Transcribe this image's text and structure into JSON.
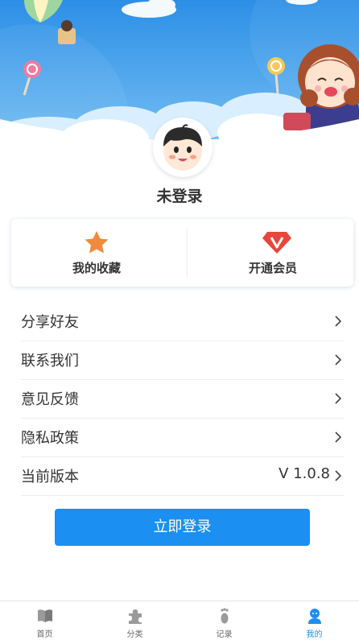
{
  "profile": {
    "username": "未登录"
  },
  "quick_actions": [
    {
      "label": "我的收藏",
      "icon": "star-icon",
      "color": "#f08a3c"
    },
    {
      "label": "开通会员",
      "icon": "vip-diamond-icon",
      "color": "#e8463c"
    }
  ],
  "menu": [
    {
      "label": "分享好友",
      "value": ""
    },
    {
      "label": "联系我们",
      "value": ""
    },
    {
      "label": "意见反馈",
      "value": ""
    },
    {
      "label": "隐私政策",
      "value": ""
    },
    {
      "label": "当前版本",
      "value": "V 1.0.8"
    }
  ],
  "login_button": {
    "label": "立即登录",
    "color": "#1b8ff2"
  },
  "tabbar": [
    {
      "label": "首页",
      "icon": "book-icon",
      "active": false
    },
    {
      "label": "分类",
      "icon": "puzzle-icon",
      "active": false
    },
    {
      "label": "记录",
      "icon": "footprint-icon",
      "active": false
    },
    {
      "label": "我的",
      "icon": "user-icon",
      "active": true
    }
  ],
  "colors": {
    "sky": "#3fa0ea",
    "accent": "#1b8ff2"
  }
}
